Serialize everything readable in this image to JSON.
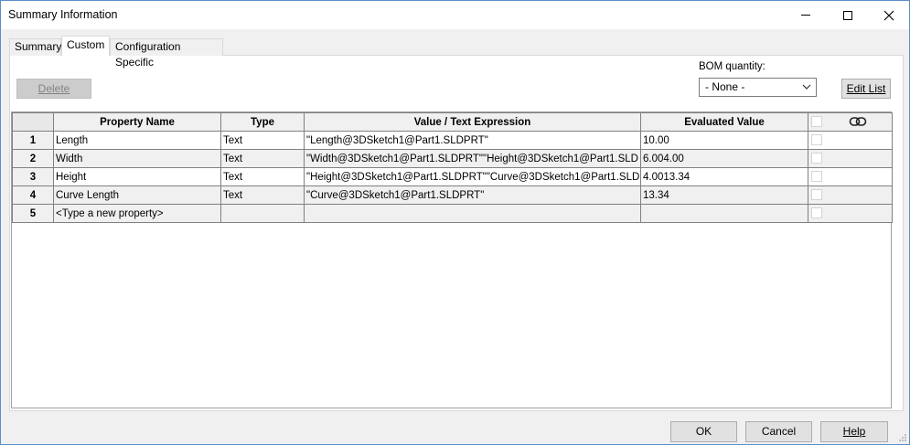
{
  "window": {
    "title": "Summary Information"
  },
  "tabs": [
    {
      "label": "Summary"
    },
    {
      "label": "Custom"
    },
    {
      "label": "Configuration Specific"
    }
  ],
  "toolbar": {
    "delete_label": "Delete",
    "bom_label": "BOM quantity:",
    "bom_value": "- None -",
    "edit_list_label": "Edit List"
  },
  "table": {
    "headers": [
      "Property Name",
      "Type",
      "Value / Text Expression",
      "Evaluated Value"
    ],
    "rows": [
      {
        "num": "1",
        "name": "Length",
        "type": "Text",
        "value": "\"Length@3DSketch1@Part1.SLDPRT\"",
        "evaluated": "10.00"
      },
      {
        "num": "2",
        "name": "Width",
        "type": "Text",
        "value": "\"Width@3DSketch1@Part1.SLDPRT\"\"Height@3DSketch1@Part1.SLD",
        "evaluated": "6.004.00"
      },
      {
        "num": "3",
        "name": "Height",
        "type": "Text",
        "value": "\"Height@3DSketch1@Part1.SLDPRT\"\"Curve@3DSketch1@Part1.SLDP",
        "evaluated": "4.0013.34"
      },
      {
        "num": "4",
        "name": "Curve Length",
        "type": "Text",
        "value": "\"Curve@3DSketch1@Part1.SLDPRT\"",
        "evaluated": "13.34"
      },
      {
        "num": "5",
        "name": "<Type a new property>",
        "type": "",
        "value": "",
        "evaluated": ""
      }
    ]
  },
  "footer": {
    "ok_label": "OK",
    "cancel_label": "Cancel",
    "help_label": "Help"
  },
  "icons": {
    "link": "link-icon",
    "close": "close-icon",
    "minimize": "minimize-icon",
    "maximize": "maximize-icon",
    "dropdown": "chevron-down-icon"
  }
}
